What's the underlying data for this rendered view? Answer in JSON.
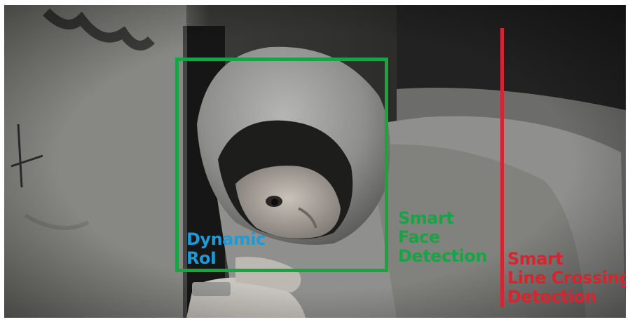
{
  "annotations": {
    "roi": {
      "line1": "Dynamic",
      "line2": "RoI",
      "color": "#1f9ad6"
    },
    "face": {
      "line1": "Smart",
      "line2": "Face",
      "line3": "Detection",
      "color": "#1aa344"
    },
    "line_crossing": {
      "line1": "Smart",
      "line2": "Line Crossing",
      "line3": "Detection",
      "color": "#d3262f"
    }
  }
}
